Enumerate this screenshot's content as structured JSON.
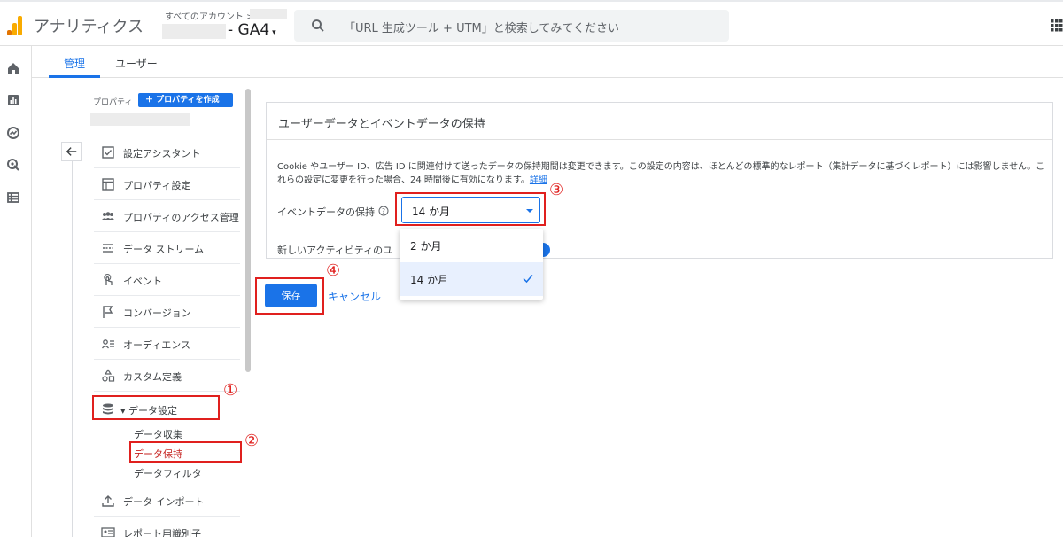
{
  "app": {
    "title": "アナリティクス",
    "account_label": "すべてのアカウント >",
    "property_name": "- GA4"
  },
  "search": {
    "placeholder": "「URL 生成ツール + UTM」と検索してみてください"
  },
  "tabs": [
    {
      "label": "管理"
    },
    {
      "label": "ユーザー"
    }
  ],
  "panel": {
    "property_label": "プロパティ",
    "create_button": "＋ プロパティを作成"
  },
  "menu": [
    {
      "label": "設定アシスタント",
      "icon": "checkbox-icon"
    },
    {
      "label": "プロパティ設定",
      "icon": "window-icon"
    },
    {
      "label": "プロパティのアクセス管理",
      "icon": "people-icon"
    },
    {
      "label": "データ ストリーム",
      "icon": "stream-icon"
    },
    {
      "label": "イベント",
      "icon": "touch-icon"
    },
    {
      "label": "コンバージョン",
      "icon": "flag-icon"
    },
    {
      "label": "オーディエンス",
      "icon": "audience-icon"
    },
    {
      "label": "カスタム定義",
      "icon": "shapes-icon"
    },
    {
      "label": "▾ データ設定",
      "icon": "database-icon"
    },
    {
      "label": "データ インポート",
      "icon": "upload-icon"
    },
    {
      "label": "レポート用識別子",
      "icon": "id-icon"
    }
  ],
  "submenu": [
    {
      "label": "データ収集"
    },
    {
      "label": "データ保持"
    },
    {
      "label": "データフィルタ"
    }
  ],
  "card": {
    "title": "ユーザーデータとイベントデータの保持",
    "description": "Cookie やユーザー ID、広告 ID に関連付けて送ったデータの保持期間は変更できます。この設定の内容は、ほとんどの標準的なレポート（集計データに基づくレポート）には影響しません。これらの設定に変更を行った場合、24 時間後に有効になります。",
    "details_link": "詳細",
    "retention_label": "イベントデータの保持",
    "retention_value": "14 か月",
    "reset_label": "新しいアクティビティのユ"
  },
  "dropdown": {
    "options": [
      {
        "label": "2 か月"
      },
      {
        "label": "14 か月"
      }
    ]
  },
  "actions": {
    "save": "保存",
    "cancel": "キャンセル"
  },
  "annotations": {
    "n1": "①",
    "n2": "②",
    "n3": "③",
    "n4": "④"
  },
  "colors": {
    "accent": "#1a73e8",
    "annotation": "#e0201e",
    "active_submenu": "#c5221f"
  }
}
